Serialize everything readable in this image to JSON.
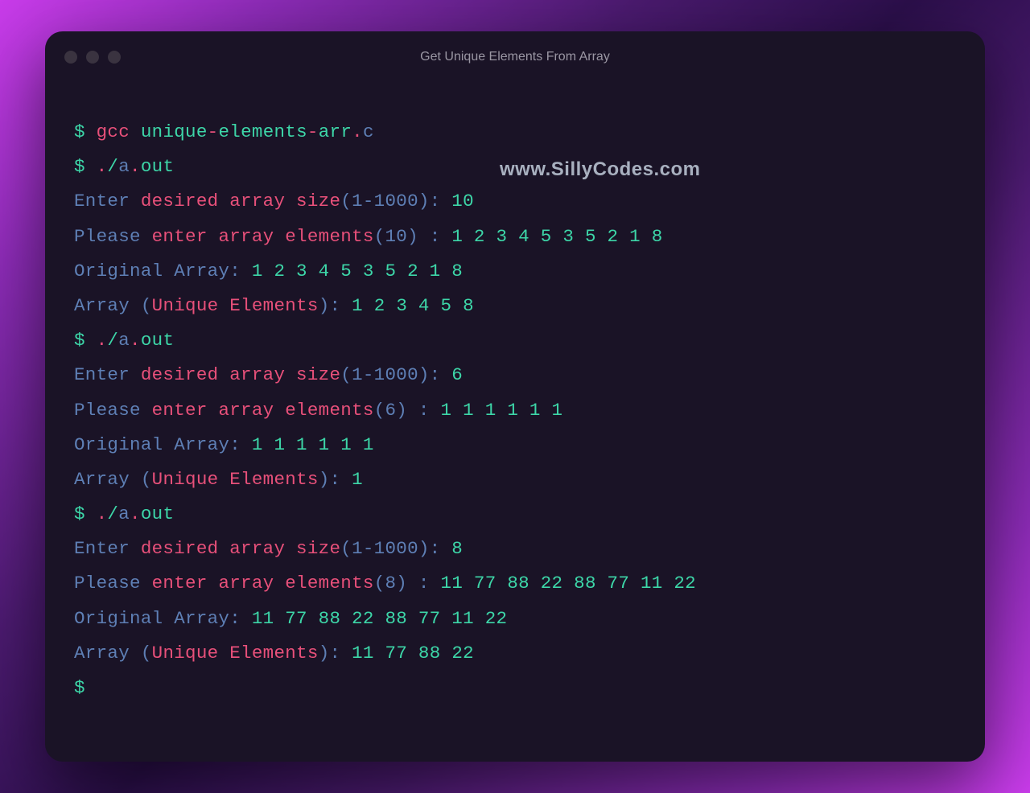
{
  "window": {
    "title": "Get Unique Elements From Array"
  },
  "watermark": "www.SillyCodes.com",
  "lines": {
    "l1_prompt": "$ ",
    "l1_cmd": "gcc",
    "l1_sp1": " ",
    "l1_arg1": "unique",
    "l1_dash1": "-",
    "l1_arg2": "elements",
    "l1_dash2": "-",
    "l1_arg3": "arr",
    "l1_dot": ".",
    "l1_ext": "c",
    "l2_prompt": "$ ",
    "l2_dot": ".",
    "l2_slash": "/",
    "l2_a": "a",
    "l2_dot2": ".",
    "l2_out": "out",
    "r1_enter": "Enter",
    "r1_mid": " desired array size",
    "r1_paren": "(1-1000): ",
    "r1_val": "10",
    "r1p_please": "Please",
    "r1p_mid": " enter array elements",
    "r1p_paren": "(10) : ",
    "r1p_vals": "1 2 3 4 5 3 5 2 1 8",
    "r1o_label": "Original Array: ",
    "r1o_vals": "1 2 3 4 5 3 5 2 1 8",
    "r1u_a": "Array ",
    "r1u_p1": "(",
    "r1u_mid": "Unique Elements",
    "r1u_p2": "): ",
    "r1u_vals": "1 2 3 4 5 8",
    "l3_prompt": "$ ",
    "l3_dot": ".",
    "l3_slash": "/",
    "l3_a": "a",
    "l3_dot2": ".",
    "l3_out": "out",
    "r2_enter": "Enter",
    "r2_mid": " desired array size",
    "r2_paren": "(1-1000): ",
    "r2_val": "6",
    "r2p_please": "Please",
    "r2p_mid": " enter array elements",
    "r2p_paren": "(6) : ",
    "r2p_vals": "1 1 1 1 1 1",
    "r2o_label": "Original Array: ",
    "r2o_vals": "1 1 1 1 1 1",
    "r2u_a": "Array ",
    "r2u_p1": "(",
    "r2u_mid": "Unique Elements",
    "r2u_p2": "): ",
    "r2u_vals": "1",
    "l4_prompt": "$ ",
    "l4_dot": ".",
    "l4_slash": "/",
    "l4_a": "a",
    "l4_dot2": ".",
    "l4_out": "out",
    "r3_enter": "Enter",
    "r3_mid": " desired array size",
    "r3_paren": "(1-1000): ",
    "r3_val": "8",
    "r3p_please": "Please",
    "r3p_mid": " enter array elements",
    "r3p_paren": "(8) : ",
    "r3p_vals": "11 77 88 22 88 77 11 22",
    "r3o_label": "Original Array: ",
    "r3o_vals": "11 77 88 22 88 77 11 22",
    "r3u_a": "Array ",
    "r3u_p1": "(",
    "r3u_mid": "Unique Elements",
    "r3u_p2": "): ",
    "r3u_vals": "11 77 88 22",
    "lend_prompt": "$"
  }
}
